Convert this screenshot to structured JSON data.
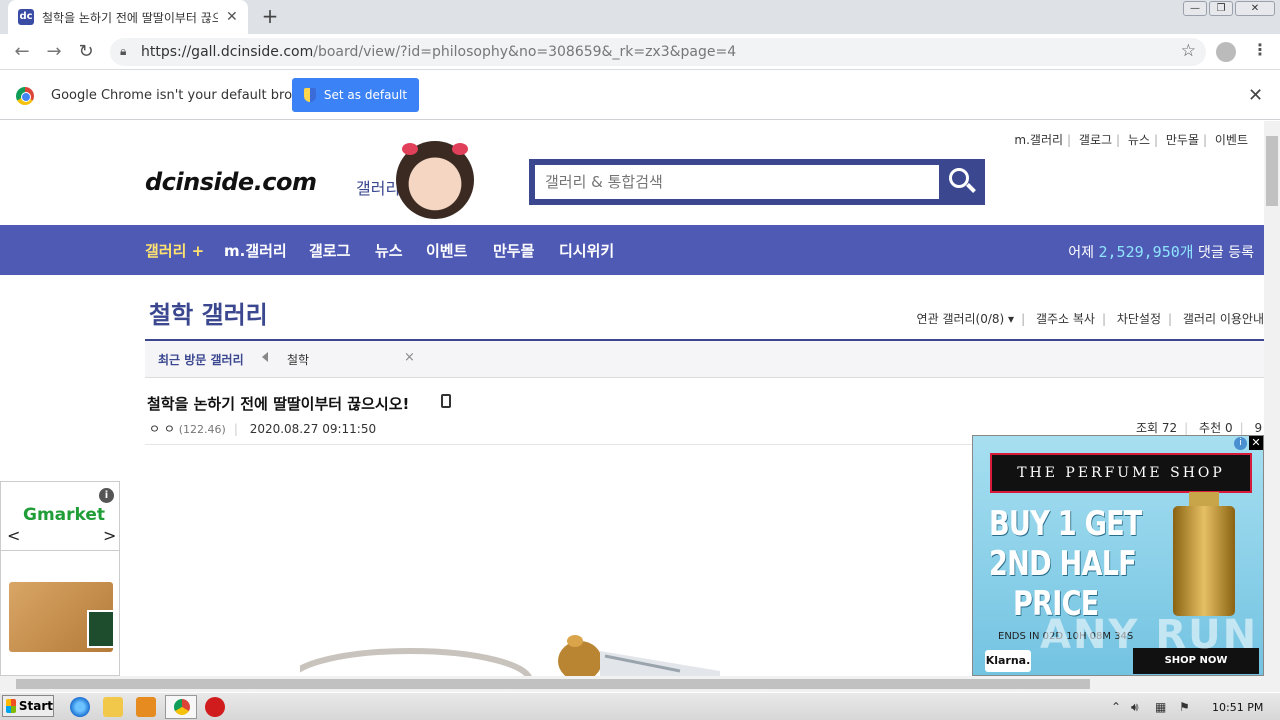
{
  "browser": {
    "tab_title": "철학을 논하기 전에 딸딸이부터 끊으",
    "tab_favicon": "dc",
    "url_host": "https://gall.dcinside.com",
    "url_path": "/board/view/?id=philosophy&no=308659&_rk=zx3&page=4",
    "infobar_text": "Google Chrome isn't your default browser",
    "set_default_label": "Set as default"
  },
  "site": {
    "top_links": [
      "m.갤러리",
      "갤로그",
      "뉴스",
      "만두몰",
      "이벤트"
    ],
    "logo": "dcinside.com",
    "logo_sub": "갤러리",
    "search_placeholder": "갤러리 & 통합검색",
    "gnb": [
      "갤러리 +",
      "m.갤러리",
      "갤로그",
      "뉴스",
      "이벤트",
      "만두몰",
      "디시위키"
    ],
    "stat_prefix": "어제",
    "stat_num": "2,529,950개",
    "stat_suffix": "댓글 등록"
  },
  "gallery": {
    "title": "철학 갤러리",
    "links": [
      "연관 갤러리(0/8) ▾",
      "갤주소 복사",
      "차단설정",
      "갤러리 이용안내"
    ],
    "recent_label": "최근 방문 갤러리",
    "recent_item": "철학",
    "recent_close": "×"
  },
  "post": {
    "title": "철학을 논하기 전에 딸딸이부터 끊으시오!",
    "author": "ㅇ ㅇ",
    "ip": "(122.46)",
    "date": "2020.08.27 09:11:50",
    "views": "조회 72",
    "recommend": "추천 0",
    "comments": "9"
  },
  "ads": {
    "left_brand": "Gmarket",
    "right_banner": "THE PERFUME SHOP",
    "promo_line1": "BUY 1 GET",
    "promo_line2": "2ND HALF",
    "promo_line3": "PRICE",
    "promo_small": "ENDS IN 02D 10H 08M 34S",
    "klarna": "Klarna.",
    "shop_now": "SHOP NOW",
    "watermark": "ANY RUN"
  },
  "taskbar": {
    "start_label": "Start",
    "clock": "10:51 PM"
  }
}
